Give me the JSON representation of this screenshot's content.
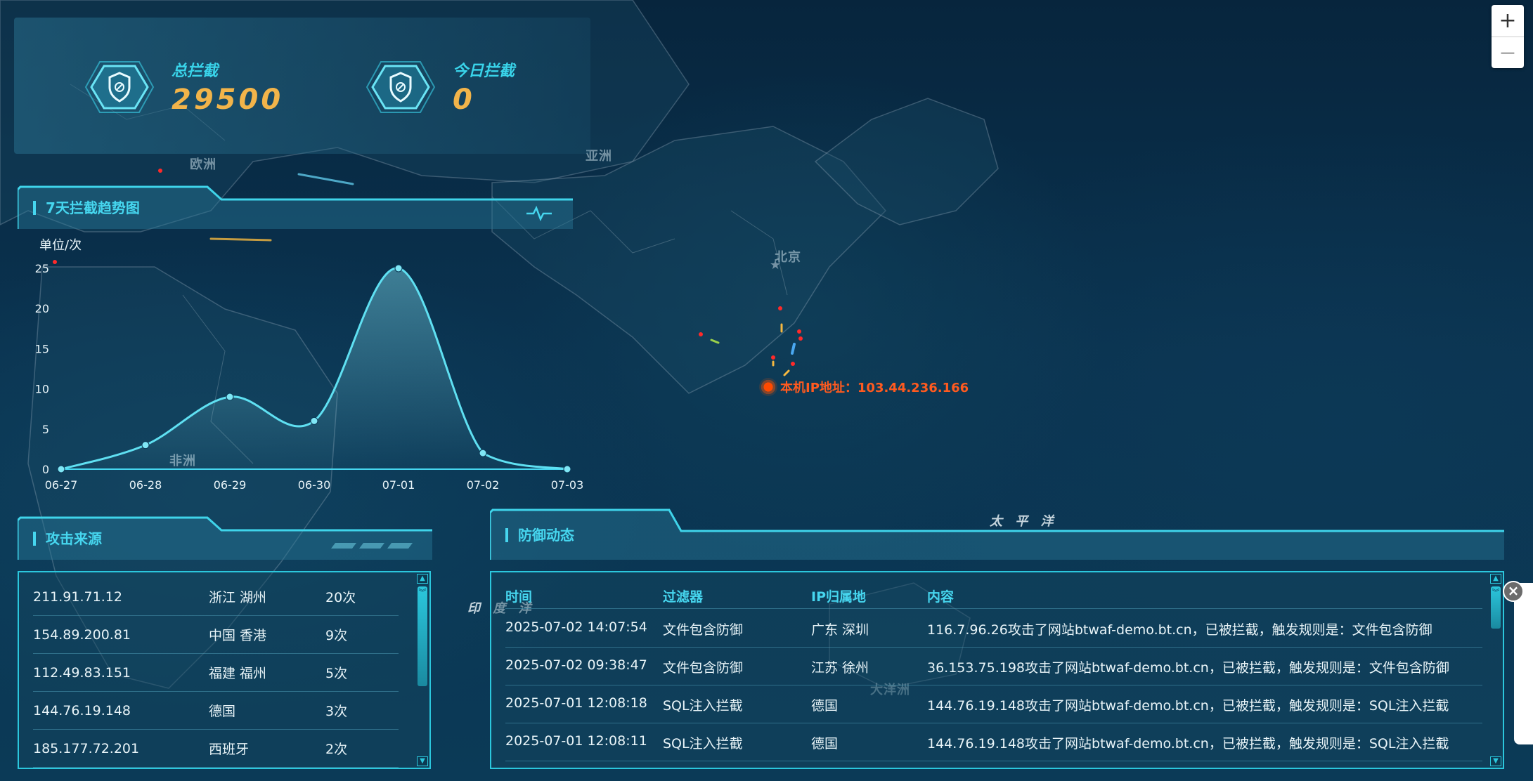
{
  "stats": {
    "total": {
      "label": "总拦截",
      "value": "29500"
    },
    "today": {
      "label": "今日拦截",
      "value": "0"
    }
  },
  "map": {
    "labels": {
      "europe": "欧洲",
      "asia": "亚洲",
      "beijing": "北京",
      "africa": "非洲",
      "pacific": "太 平 洋",
      "indian": "印 度 洋",
      "oceania": "大洋洲"
    },
    "local_ip": "本机IP地址：103.44.236.166"
  },
  "trend": {
    "title": "7天拦截趋势图"
  },
  "chart_data": {
    "type": "line",
    "title": "",
    "ylabel": "单位/次",
    "xlabel": "",
    "categories": [
      "06-27",
      "06-28",
      "06-29",
      "06-30",
      "07-01",
      "07-02",
      "07-03"
    ],
    "values": [
      0,
      3,
      9,
      6,
      25,
      2,
      0
    ],
    "yticks": [
      0,
      5,
      10,
      15,
      20,
      25
    ],
    "ylim": [
      0,
      25
    ],
    "grid": false,
    "colors": {
      "line": "#5fe0f2"
    }
  },
  "sources": {
    "title": "攻击来源",
    "rows": [
      {
        "ip": "211.91.71.12",
        "location": "浙江 湖州",
        "count": "20次"
      },
      {
        "ip": "154.89.200.81",
        "location": "中国 香港",
        "count": "9次"
      },
      {
        "ip": "112.49.83.151",
        "location": "福建 福州",
        "count": "5次"
      },
      {
        "ip": "144.76.19.148",
        "location": "德国",
        "count": "3次"
      },
      {
        "ip": "185.177.72.201",
        "location": "西班牙",
        "count": "2次"
      }
    ]
  },
  "defense": {
    "title": "防御动态",
    "columns": [
      "时间",
      "过滤器",
      "IP归属地",
      "内容"
    ],
    "rows": [
      {
        "time": "2025-07-02 14:07:54",
        "filter": "文件包含防御",
        "location": "广东 深圳",
        "content": "116.7.96.26攻击了网站btwaf-demo.bt.cn，已被拦截，触发规则是：文件包含防御"
      },
      {
        "time": "2025-07-02 09:38:47",
        "filter": "文件包含防御",
        "location": "江苏 徐州",
        "content": "36.153.75.198攻击了网站btwaf-demo.bt.cn，已被拦截，触发规则是：文件包含防御"
      },
      {
        "time": "2025-07-01 12:08:18",
        "filter": "SQL注入拦截",
        "location": "德国",
        "content": "144.76.19.148攻击了网站btwaf-demo.bt.cn，已被拦截，触发规则是：SQL注入拦截"
      },
      {
        "time": "2025-07-01 12:08:11",
        "filter": "SQL注入拦截",
        "location": "德国",
        "content": "144.76.19.148攻击了网站btwaf-demo.bt.cn，已被拦截，触发规则是：SQL注入拦截"
      }
    ]
  },
  "zoom": {
    "in": "+",
    "out": "−"
  },
  "colors": {
    "accent": "#46d6ef",
    "value": "#f2b44a",
    "local_ip": "#ff5a1f"
  },
  "icons": {
    "shield": "shield-icon",
    "pulse": "pulse-icon",
    "close": "close-icon"
  }
}
